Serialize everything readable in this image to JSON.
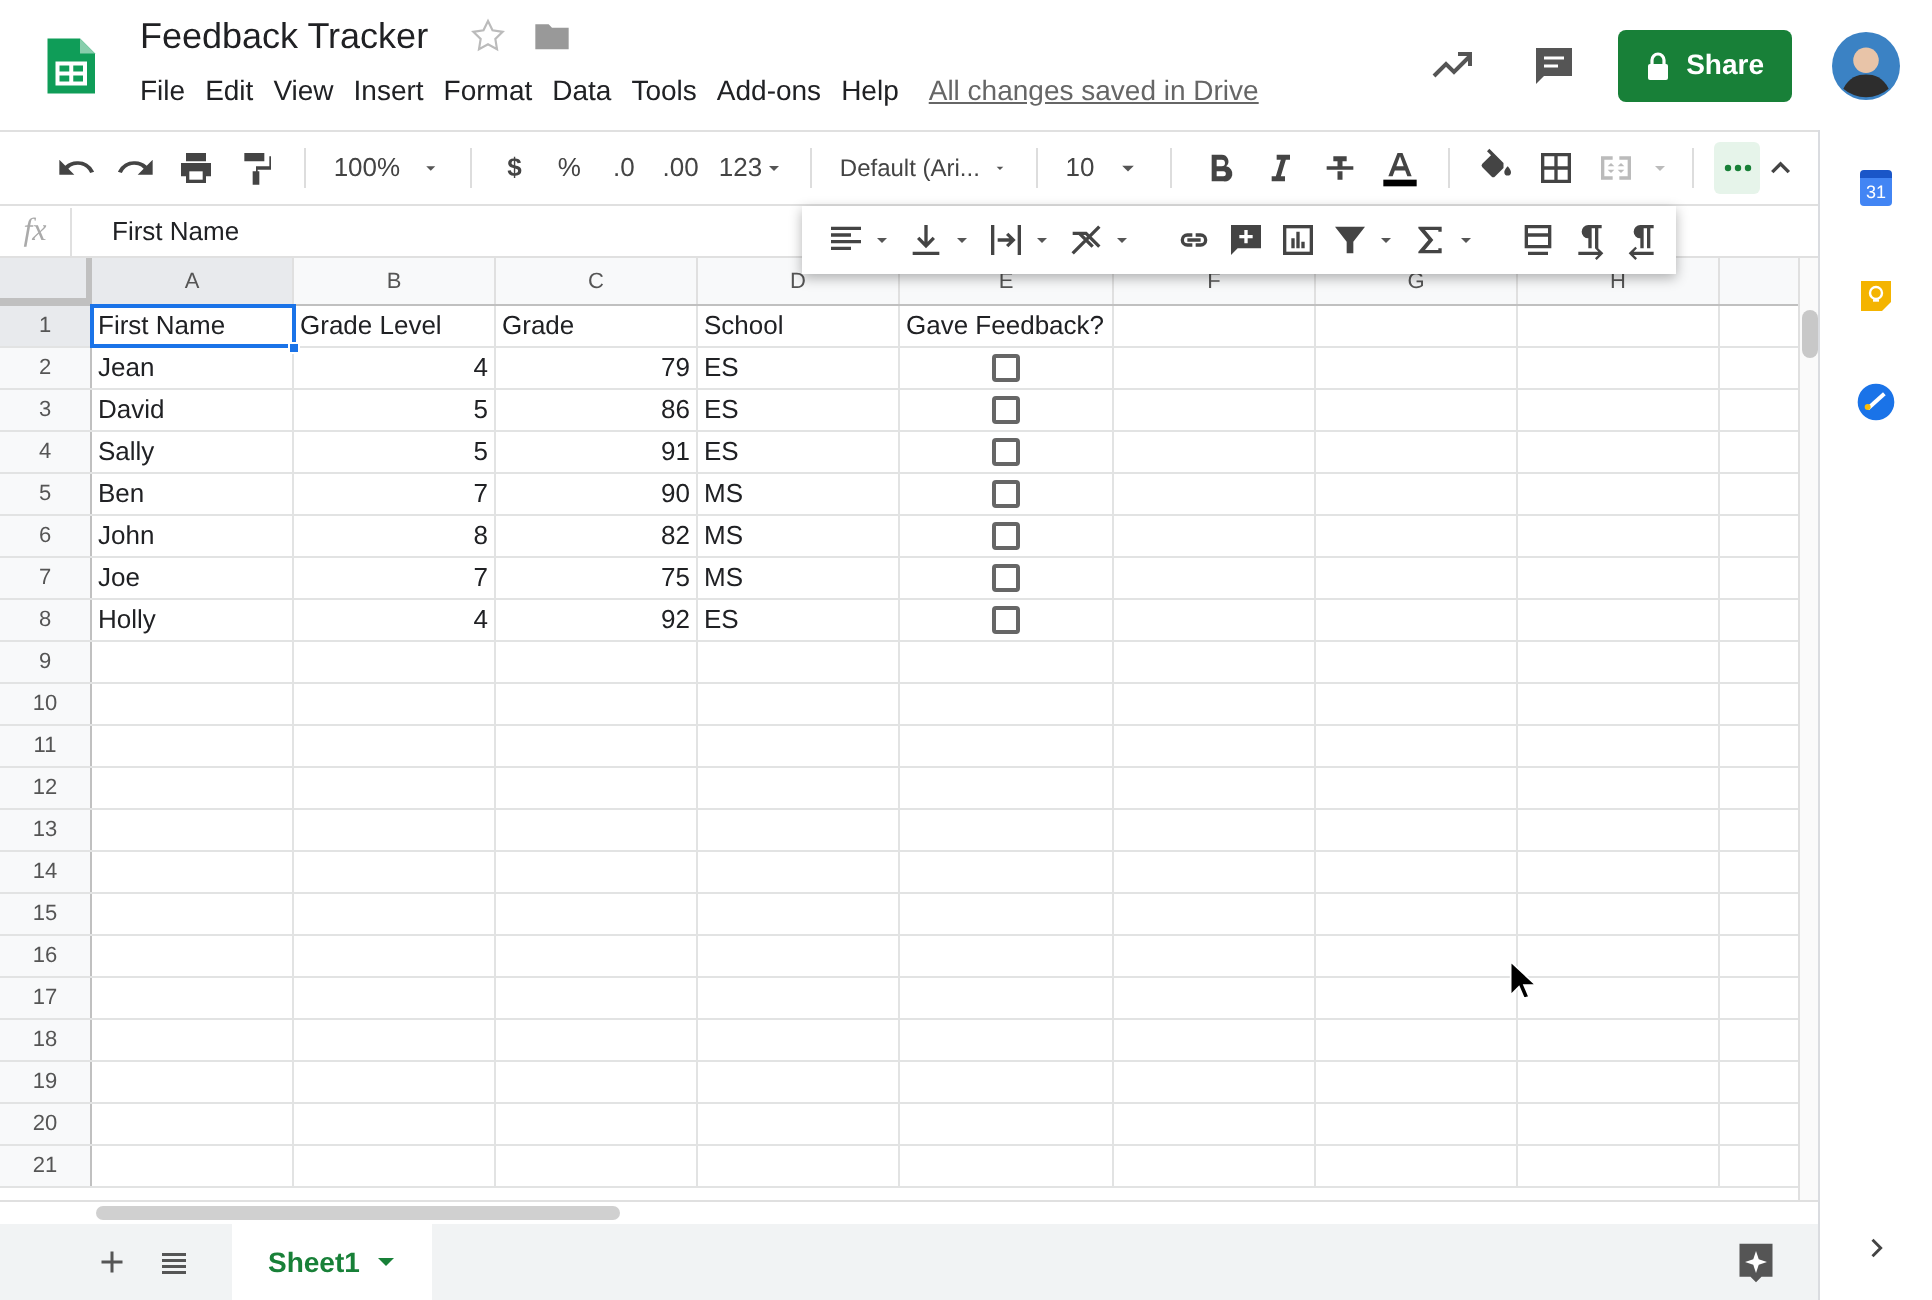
{
  "document": {
    "title": "Feedback Tracker",
    "starred": false
  },
  "menu": [
    "File",
    "Edit",
    "View",
    "Insert",
    "Format",
    "Data",
    "Tools",
    "Add-ons",
    "Help"
  ],
  "save_status": "All changes saved in Drive",
  "share_button": "Share",
  "toolbar": {
    "zoom": "100%",
    "currency": "$",
    "percent": "%",
    "decimal_decrease": ".0",
    "decimal_increase": ".00",
    "number_format": "123",
    "font": "Default (Ari...",
    "font_size": "10"
  },
  "formula_bar": {
    "fx": "fx",
    "value": "First Name"
  },
  "columns": [
    {
      "label": "A",
      "selected": true
    },
    {
      "label": "B",
      "selected": false
    },
    {
      "label": "C",
      "selected": false
    },
    {
      "label": "D",
      "selected": false
    },
    {
      "label": "E",
      "selected": false
    },
    {
      "label": "F",
      "selected": false
    },
    {
      "label": "G",
      "selected": false
    },
    {
      "label": "H",
      "selected": false
    }
  ],
  "rows": [
    {
      "number": "1",
      "selected": true,
      "cells": [
        {
          "kind": "text",
          "text": "First Name"
        },
        {
          "kind": "text",
          "text": "Grade Level"
        },
        {
          "kind": "text",
          "text": "Grade"
        },
        {
          "kind": "text",
          "text": "School"
        },
        {
          "kind": "text",
          "text": "Gave Feedback?"
        }
      ]
    },
    {
      "number": "2",
      "selected": false,
      "cells": [
        {
          "kind": "text",
          "text": "Jean"
        },
        {
          "kind": "number",
          "text": "4"
        },
        {
          "kind": "number",
          "text": "79"
        },
        {
          "kind": "text",
          "text": "ES"
        },
        {
          "kind": "checkbox",
          "checked": false
        }
      ]
    },
    {
      "number": "3",
      "selected": false,
      "cells": [
        {
          "kind": "text",
          "text": "David"
        },
        {
          "kind": "number",
          "text": "5"
        },
        {
          "kind": "number",
          "text": "86"
        },
        {
          "kind": "text",
          "text": "ES"
        },
        {
          "kind": "checkbox",
          "checked": false
        }
      ]
    },
    {
      "number": "4",
      "selected": false,
      "cells": [
        {
          "kind": "text",
          "text": "Sally"
        },
        {
          "kind": "number",
          "text": "5"
        },
        {
          "kind": "number",
          "text": "91"
        },
        {
          "kind": "text",
          "text": "ES"
        },
        {
          "kind": "checkbox",
          "checked": false
        }
      ]
    },
    {
      "number": "5",
      "selected": false,
      "cells": [
        {
          "kind": "text",
          "text": "Ben"
        },
        {
          "kind": "number",
          "text": "7"
        },
        {
          "kind": "number",
          "text": "90"
        },
        {
          "kind": "text",
          "text": "MS"
        },
        {
          "kind": "checkbox",
          "checked": false
        }
      ]
    },
    {
      "number": "6",
      "selected": false,
      "cells": [
        {
          "kind": "text",
          "text": "John"
        },
        {
          "kind": "number",
          "text": "8"
        },
        {
          "kind": "number",
          "text": "82"
        },
        {
          "kind": "text",
          "text": "MS"
        },
        {
          "kind": "checkbox",
          "checked": false
        }
      ]
    },
    {
      "number": "7",
      "selected": false,
      "cells": [
        {
          "kind": "text",
          "text": "Joe"
        },
        {
          "kind": "number",
          "text": "7"
        },
        {
          "kind": "number",
          "text": "75"
        },
        {
          "kind": "text",
          "text": "MS"
        },
        {
          "kind": "checkbox",
          "checked": false
        }
      ]
    },
    {
      "number": "8",
      "selected": false,
      "cells": [
        {
          "kind": "text",
          "text": "Holly"
        },
        {
          "kind": "number",
          "text": "4"
        },
        {
          "kind": "number",
          "text": "92"
        },
        {
          "kind": "text",
          "text": "ES"
        },
        {
          "kind": "checkbox",
          "checked": false
        }
      ]
    },
    {
      "number": "9",
      "selected": false,
      "cells": []
    },
    {
      "number": "10",
      "selected": false,
      "cells": []
    },
    {
      "number": "11",
      "selected": false,
      "cells": []
    },
    {
      "number": "12",
      "selected": false,
      "cells": []
    },
    {
      "number": "13",
      "selected": false,
      "cells": []
    },
    {
      "number": "14",
      "selected": false,
      "cells": []
    },
    {
      "number": "15",
      "selected": false,
      "cells": []
    },
    {
      "number": "16",
      "selected": false,
      "cells": []
    },
    {
      "number": "17",
      "selected": false,
      "cells": []
    },
    {
      "number": "18",
      "selected": false,
      "cells": []
    },
    {
      "number": "19",
      "selected": false,
      "cells": []
    },
    {
      "number": "20",
      "selected": false,
      "cells": []
    },
    {
      "number": "21",
      "selected": false,
      "cells": []
    }
  ],
  "sheet_tabs": [
    {
      "label": "Sheet1",
      "selected": true
    }
  ],
  "side_panel": {
    "calendar_day": "31"
  }
}
